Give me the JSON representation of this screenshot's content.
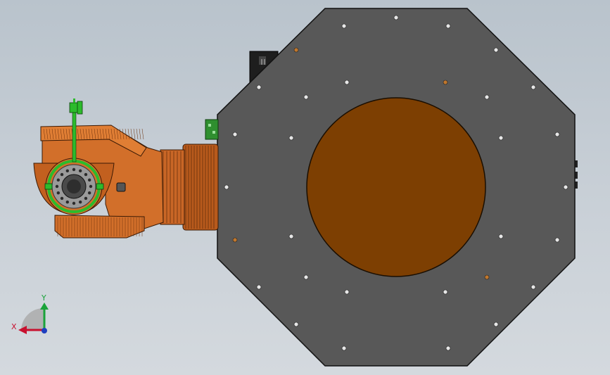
{
  "viewport": {
    "background_top": "#b9c3cc",
    "background_bottom": "#d4d9de"
  },
  "triad": {
    "x_label": "X",
    "y_label": "Y",
    "x_color": "#c8102e",
    "y_color": "#1aa33a",
    "z_color": "#1f3fbf"
  },
  "colors": {
    "plate": "#5a5a5a",
    "plate_edge": "#1a1a1a",
    "disc": "#7f3f00",
    "robot_orange": "#d9762b",
    "robot_dark": "#8a3f12",
    "green_accent": "#2cbb2c",
    "hole": "#e8e8e8"
  },
  "components": [
    "octagon-mounting-plate",
    "orange-rotary-disc",
    "robot-arm",
    "green-indicator-handle",
    "side-connector"
  ]
}
